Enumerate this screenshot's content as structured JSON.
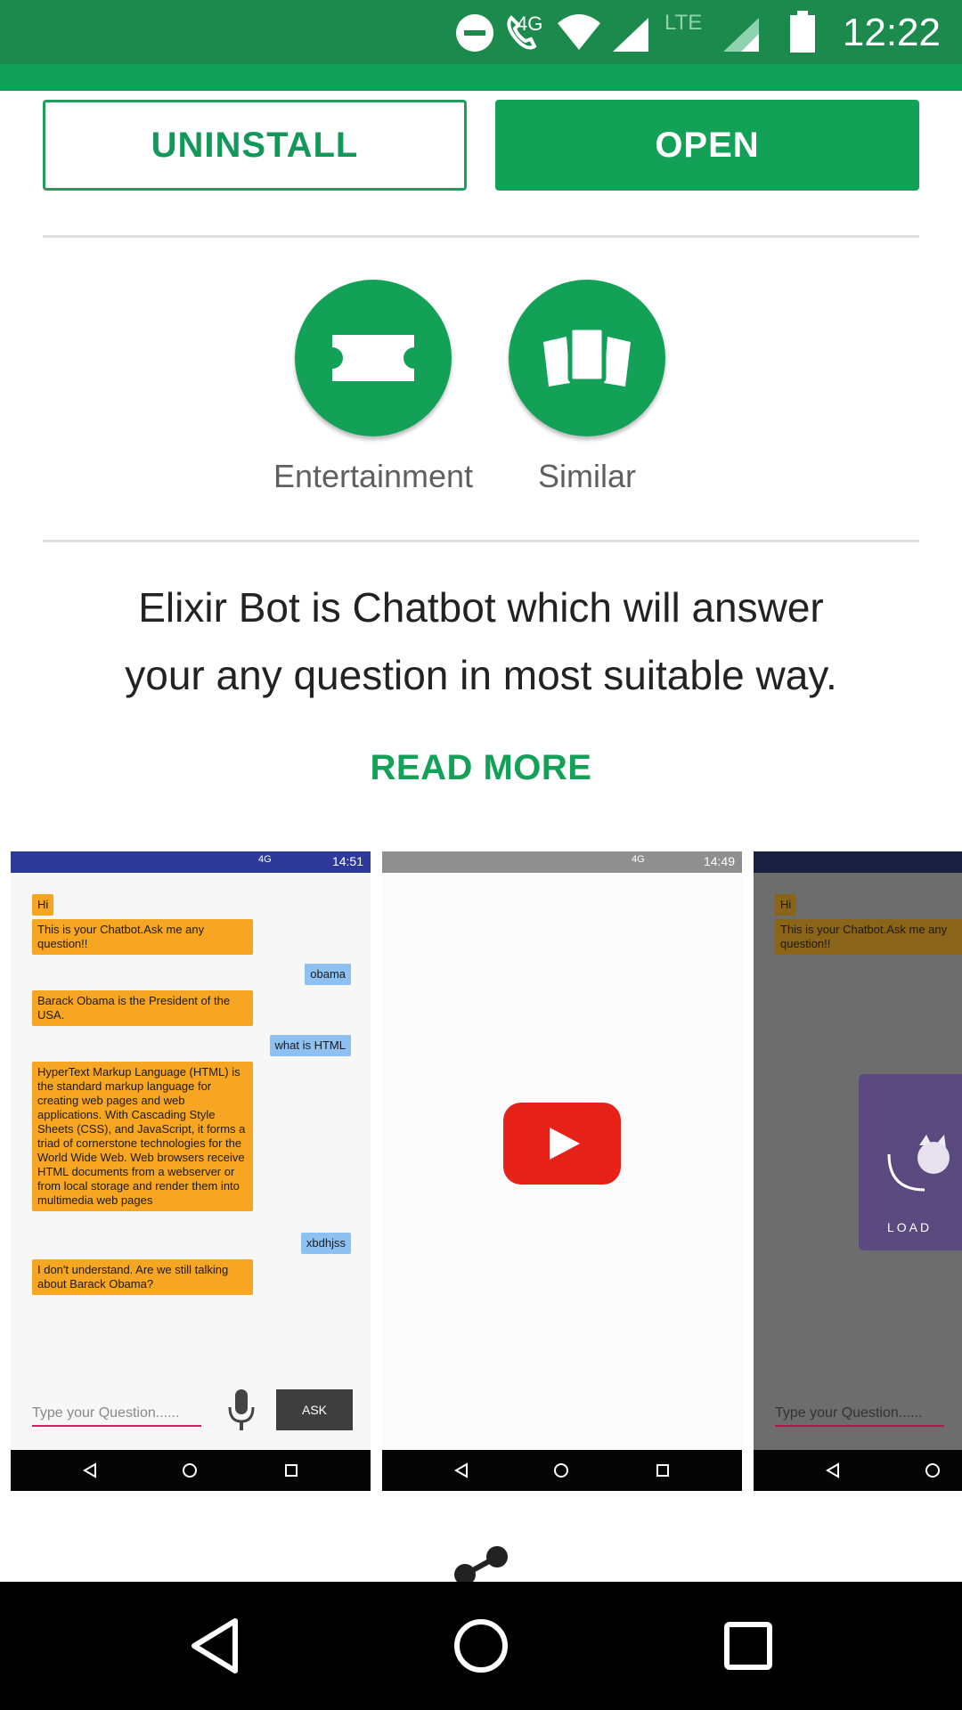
{
  "status_bar": {
    "time": "12:22",
    "network_4g": "4G",
    "network_lte": "LTE"
  },
  "actions": {
    "uninstall_label": "UNINSTALL",
    "open_label": "OPEN"
  },
  "badges": [
    {
      "label": "Entertainment",
      "icon": "ticket-icon"
    },
    {
      "label": "Similar",
      "icon": "similar-apps-icon"
    }
  ],
  "description": {
    "line1": "Elixir Bot is Chatbot which will answer",
    "line2": "your any question in most suitable way."
  },
  "read_more_label": "READ MORE",
  "screenshots": {
    "shot1": {
      "status_time": "14:51",
      "status_network": "4G",
      "messages": [
        {
          "from": "bot",
          "text": "Hi"
        },
        {
          "from": "bot",
          "text": "This is your Chatbot.Ask me any question!!"
        },
        {
          "from": "user",
          "text": "obama"
        },
        {
          "from": "bot",
          "text": "Barack Obama is the President of the USA."
        },
        {
          "from": "user",
          "text": "what is HTML"
        },
        {
          "from": "bot",
          "text": "HyperText Markup Language (HTML) is the standard markup language for creating web pages and web applications. With Cascading Style Sheets (CSS), and JavaScript, it forms a triad of cornerstone technologies for the World Wide Web. Web browsers receive HTML documents from a webserver or from local storage and render them into multimedia web pages"
        },
        {
          "from": "user",
          "text": "xbdhjss"
        },
        {
          "from": "bot",
          "text": "  I don't understand. Are we still talking about Barack Obama?"
        }
      ],
      "input_placeholder": "Type your Question......",
      "ask_label": "ASK"
    },
    "shot2": {
      "status_time": "14:49",
      "status_network": "4G"
    },
    "shot3": {
      "messages": [
        {
          "from": "bot",
          "text": "Hi"
        },
        {
          "from": "bot",
          "text": "This is your Chatbot.Ask me any question!!"
        }
      ],
      "loading_label": "LOAD",
      "input_placeholder": "Type your Question......"
    }
  },
  "colors": {
    "primary_green": "#13a158",
    "status_green": "#1b8a4c",
    "bot_bubble": "#f7a623",
    "user_bubble": "#8ec0f2",
    "youtube_red": "#e62117"
  }
}
